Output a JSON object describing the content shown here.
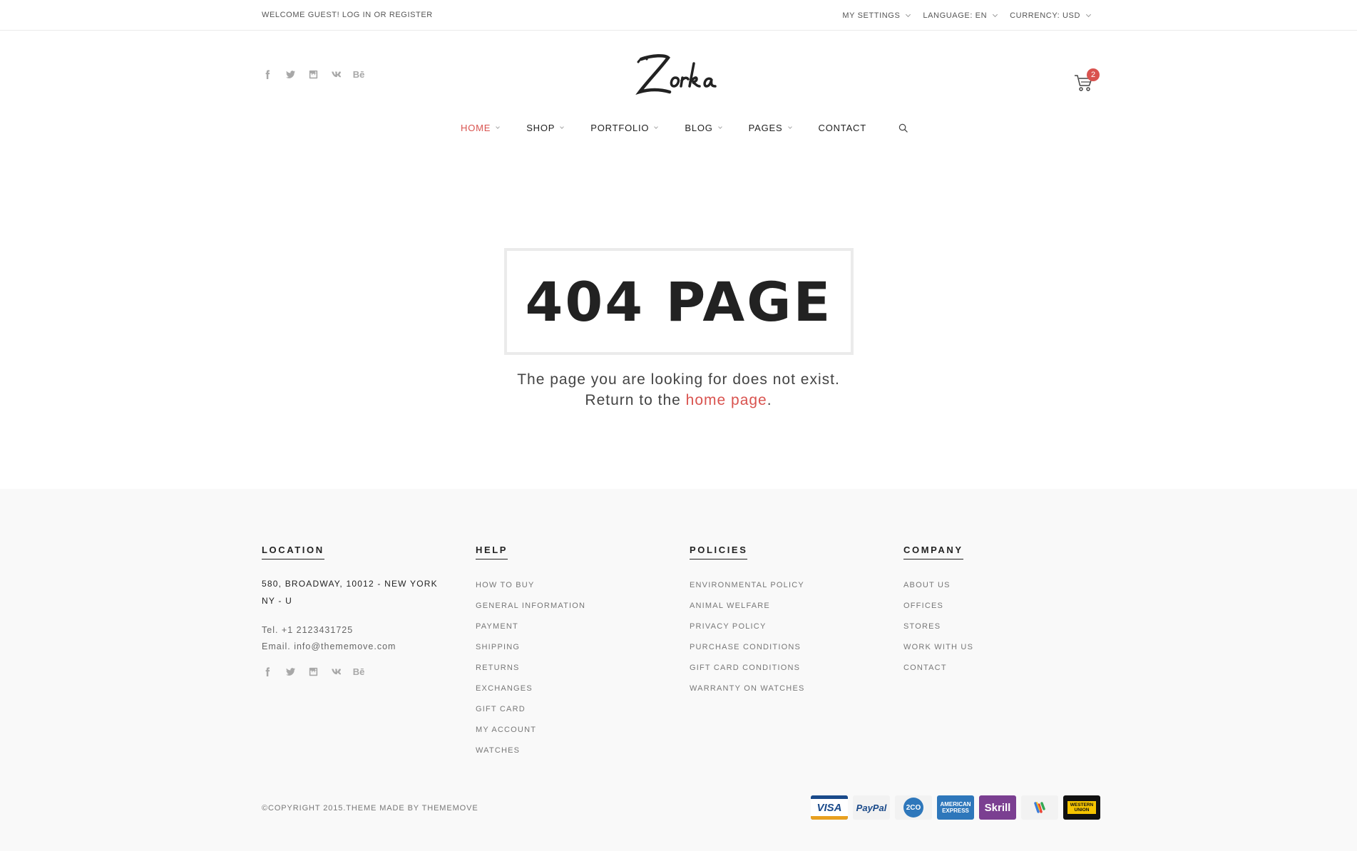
{
  "topbar": {
    "welcome_prefix": "WELCOME GUEST! ",
    "login": "LOG IN",
    "or": " OR ",
    "register": "REGISTER",
    "settings_label": "MY SETTINGS",
    "language_label": "LANGUAGE: EN",
    "currency_label": "CURRENCY: USD"
  },
  "header": {
    "logo_text": "Zorka",
    "cart_count": "2",
    "social_icons": [
      "facebook-icon",
      "twitter-icon",
      "instagram-icon",
      "vk-icon",
      "behance-icon"
    ]
  },
  "nav": {
    "items": [
      {
        "label": "HOME",
        "active": true,
        "has_dropdown": true
      },
      {
        "label": "SHOP",
        "has_dropdown": true
      },
      {
        "label": "PORTFOLIO",
        "has_dropdown": true
      },
      {
        "label": "BLOG",
        "has_dropdown": true
      },
      {
        "label": "PAGES",
        "has_dropdown": true
      },
      {
        "label": "CONTACT",
        "has_dropdown": false
      }
    ]
  },
  "main": {
    "title": "404 PAGE",
    "message_line1": "The page you are looking for does not exist.",
    "message_line2_prefix": "Return to the ",
    "home_link": "home page",
    "message_line2_suffix": "."
  },
  "footer": {
    "location": {
      "title": "LOCATION",
      "address": "580, BROADWAY, 10012 - NEW YORK NY - U",
      "tel": "Tel. +1 2123431725",
      "email": "Email. info@thememove.com"
    },
    "help": {
      "title": "HELP",
      "links": [
        "HOW TO BUY",
        "GENERAL INFORMATION",
        "PAYMENT",
        "SHIPPING",
        "RETURNS",
        "EXCHANGES",
        "GIFT CARD",
        "MY ACCOUNT",
        "WATCHES"
      ]
    },
    "policies": {
      "title": "POLICIES",
      "links": [
        "ENVIRONMENTAL POLICY",
        "ANIMAL WELFARE",
        "PRIVACY POLICY",
        "PURCHASE CONDITIONS",
        "GIFT CARD CONDITIONS",
        "WARRANTY ON WATCHES"
      ]
    },
    "company": {
      "title": "COMPANY",
      "links": [
        "ABOUT US",
        "OFFICES",
        "STORES",
        "WORK WITH US",
        "CONTACT"
      ]
    },
    "copyright": "©COPYRIGHT 2015.THEME MADE BY THEMEMOVE",
    "payments": [
      {
        "label": "VISA",
        "color": "#1a4a8a"
      },
      {
        "label": "PayPal",
        "color": "#f2f2f2"
      },
      {
        "label": "2CO",
        "color": "#f2f2f2"
      },
      {
        "label": "AMERICAN EXPRESS",
        "color": "#2e77bb"
      },
      {
        "label": "Skrill",
        "color": "#7b3f91"
      },
      {
        "label": "",
        "color": "#f2f2f2"
      },
      {
        "label": "WESTERN UNION",
        "color": "#111111"
      }
    ]
  },
  "colors": {
    "accent": "#d9534f",
    "text_dark": "#222222",
    "footer_bg": "#f9f9f9"
  }
}
